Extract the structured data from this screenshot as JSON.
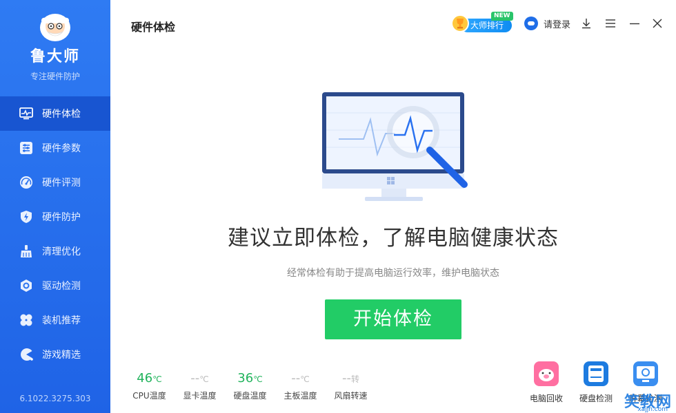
{
  "sidebar": {
    "brand_name": "鲁大师",
    "brand_tagline": "专注硬件防护",
    "items": [
      {
        "label": "硬件体检",
        "icon": "pulse-monitor-icon",
        "active": true
      },
      {
        "label": "硬件参数",
        "icon": "sliders-icon",
        "active": false
      },
      {
        "label": "硬件评测",
        "icon": "speedometer-icon",
        "active": false
      },
      {
        "label": "硬件防护",
        "icon": "shield-bolt-icon",
        "active": false
      },
      {
        "label": "清理优化",
        "icon": "broom-icon",
        "active": false
      },
      {
        "label": "驱动检测",
        "icon": "gear-hex-icon",
        "active": false
      },
      {
        "label": "装机推荐",
        "icon": "clover-icon",
        "active": false
      },
      {
        "label": "游戏精选",
        "icon": "pacman-icon",
        "active": false
      }
    ],
    "version": "6.1022.3275.303"
  },
  "header": {
    "title": "硬件体检",
    "rank_label": "大师排行",
    "new_badge": "NEW",
    "login_label": "请登录",
    "window_controls": [
      "download-icon",
      "menu-icon",
      "minimize-icon",
      "close-icon"
    ]
  },
  "main": {
    "headline": "建议立即体检，了解电脑健康状态",
    "subline": "经常体检有助于提高电脑运行效率，维护电脑状态",
    "start_button": "开始体检",
    "stats": [
      {
        "value": "46",
        "unit": "℃",
        "label": "CPU温度",
        "status": "ok"
      },
      {
        "value": "--",
        "unit": "℃",
        "label": "显卡温度",
        "status": "na"
      },
      {
        "value": "36",
        "unit": "℃",
        "label": "硬盘温度",
        "status": "ok"
      },
      {
        "value": "--",
        "unit": "℃",
        "label": "主板温度",
        "status": "na"
      },
      {
        "value": "--",
        "unit": "转",
        "label": "风扇转速",
        "status": "na"
      }
    ],
    "tools": [
      {
        "label": "电脑回收",
        "icon": "pig-icon"
      },
      {
        "label": "硬盘检测",
        "icon": "hard-disk-icon"
      },
      {
        "label": "屏幕检测",
        "icon": "monitor-check-icon"
      }
    ]
  },
  "watermark": {
    "text": "笑教网",
    "sub": "xajjn.com"
  },
  "colors": {
    "sidebar": "#2a72f0",
    "sidebar_active": "#1855d1",
    "primary_button": "#22cc66",
    "ok_value": "#21b35c",
    "na_value": "#bbbbbb"
  }
}
